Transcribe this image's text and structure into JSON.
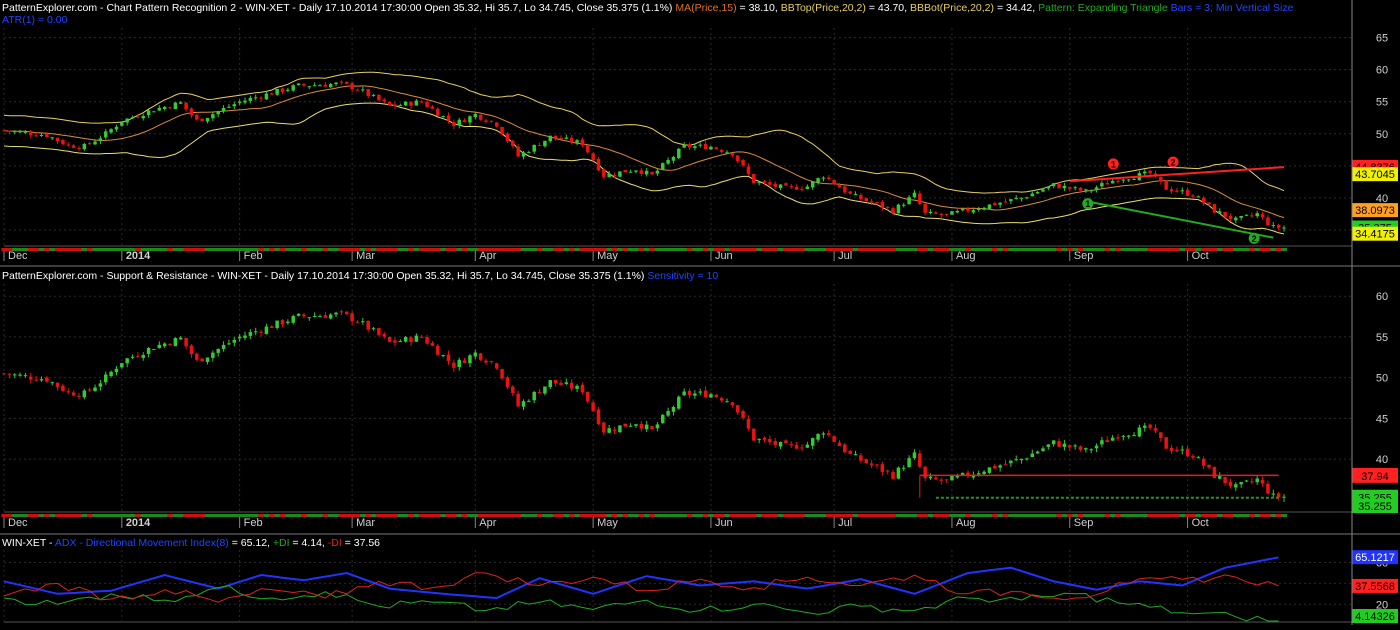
{
  "colors": {
    "bg": "#000000",
    "grid": "#2a2a2a",
    "axis_text": "#d0d0d0",
    "up": "#33cc33",
    "down": "#ee1111",
    "ma": "#d98c3a",
    "bbtop": "#e8d060",
    "bbbot": "#e8e070",
    "pattern_red": "#ff2020",
    "pattern_green": "#22aa22",
    "adx": "#2233ff",
    "plus_di": "#22aa22",
    "minus_di": "#dd2222",
    "support": "#2f8f2f",
    "resistance": "#e02020",
    "info_blue": "#2244ff"
  },
  "panel1": {
    "header": [
      {
        "text": "PatternExplorer.com - Chart Pattern Recognition 2 - WIN-XET - Daily 17.10.2014 17:30:00 Open 35.32, Hi 35.7, Lo 34.745, Close 35.375 (1.1%) ",
        "color": "#ffffff"
      },
      {
        "text": "MA(Price,15)",
        "color": "#e07020"
      },
      {
        "text": " = 38.10, ",
        "color": "#ffffff"
      },
      {
        "text": "BBTop(Price,20,2)",
        "color": "#e8d060"
      },
      {
        "text": " = 43.70, ",
        "color": "#ffffff"
      },
      {
        "text": "BBBot(Price,20,2)",
        "color": "#e8d060"
      },
      {
        "text": " = 34.42, ",
        "color": "#ffffff"
      },
      {
        "text": "Pattern: Expanding Triangle",
        "color": "#22aa22"
      },
      {
        "text": "  Bars = 3; Min Vertical Size",
        "color": "#2244ff"
      }
    ],
    "subheader": "ATR(1) = 0.00",
    "yticks": [
      "65",
      "60",
      "55",
      "50",
      "45",
      "40",
      "35"
    ],
    "ylim": [
      32.5,
      66.5
    ],
    "price_tags": [
      {
        "label": "44.8376",
        "value": 44.8376,
        "bg": "#ff2020",
        "fg": "#000000"
      },
      {
        "label": "43.7045",
        "value": 43.7045,
        "bg": "#f0f000",
        "fg": "#000000"
      },
      {
        "label": "38.0973",
        "value": 38.0973,
        "bg": "#ffa020",
        "fg": "#000000"
      },
      {
        "label": "35.3759",
        "value": 35.3759,
        "bg": "#22cc22",
        "fg": "#000000"
      },
      {
        "label": "35.375",
        "value": 35.375,
        "bg": "#22cc22",
        "fg": "#000000"
      },
      {
        "label": "34.4175",
        "value": 34.4175,
        "bg": "#f0f000",
        "fg": "#000000"
      }
    ],
    "pattern_markers": [
      {
        "label": "1",
        "day": 260,
        "value": 45.3,
        "color": "#ff2020"
      },
      {
        "label": "2",
        "day": 274,
        "value": 45.6,
        "color": "#ff2020"
      },
      {
        "label": "1",
        "day": 254,
        "value": 39.1,
        "color": "#22aa22"
      },
      {
        "label": "2",
        "day": 293,
        "value": 33.7,
        "color": "#22aa22"
      }
    ]
  },
  "panel2": {
    "header": [
      {
        "text": "PatternExplorer.com - Support & Resistance - WIN-XET - Daily 17.10.2014 17:30:00 Open 35.32, Hi 35.7, Lo 34.745, Close 35.375 (1.1%) ",
        "color": "#ffffff"
      },
      {
        "text": "Sensitivity = 10",
        "color": "#2244ff"
      }
    ],
    "yticks": [
      "60",
      "55",
      "50",
      "45",
      "40"
    ],
    "ylim": [
      33.5,
      61.5
    ],
    "price_tags": [
      {
        "label": "38.05",
        "value": 38.05,
        "bg": "#ff2020",
        "fg": "#000000"
      },
      {
        "label": "37.94",
        "value": 37.94,
        "bg": "#ff2020",
        "fg": "#000000"
      },
      {
        "label": "35.375",
        "value": 35.375,
        "bg": "#22cc22",
        "fg": "#000000"
      },
      {
        "label": "35.255",
        "value": 35.255,
        "bg": "#22cc22",
        "fg": "#000000"
      },
      {
        "label": "35.255",
        "value": 34.0,
        "bg": "#22cc22",
        "fg": "#000000"
      }
    ]
  },
  "panel3": {
    "header": [
      {
        "text": "WIN-XET - ",
        "color": "#ffffff"
      },
      {
        "text": "ADX - Directional Movement Index(8)",
        "color": "#2244ff"
      },
      {
        "text": " = 65.12, ",
        "color": "#ffffff"
      },
      {
        "text": "+DI",
        "color": "#22aa22"
      },
      {
        "text": " = 4.14, ",
        "color": "#ffffff"
      },
      {
        "text": "-DI",
        "color": "#dd2222"
      },
      {
        "text": " = 37.56",
        "color": "#ffffff"
      }
    ],
    "yticks": [
      "60",
      "40",
      "20"
    ],
    "ylim": [
      3,
      72
    ],
    "value_tags": [
      {
        "label": "65.1217",
        "value": 65.12,
        "bg": "#2233ff",
        "fg": "#ffffff"
      },
      {
        "label": "37.5568",
        "value": 37.56,
        "bg": "#ff2020",
        "fg": "#000000"
      },
      {
        "label": "4.14326",
        "value": 4.14,
        "bg": "#22cc22",
        "fg": "#000000"
      }
    ]
  },
  "months": [
    {
      "label": "Dec",
      "day": 0
    },
    {
      "label": "2014",
      "day": 22
    },
    {
      "label": "Feb",
      "day": 44
    },
    {
      "label": "Mar",
      "day": 65
    },
    {
      "label": "Apr",
      "day": 88
    },
    {
      "label": "May",
      "day": 110
    },
    {
      "label": "Jun",
      "day": 132
    },
    {
      "label": "Jul",
      "day": 155
    },
    {
      "label": "Aug",
      "day": 177
    },
    {
      "label": "Sep",
      "day": 199
    },
    {
      "label": "Oct",
      "day": 221
    }
  ],
  "chart_data": [
    {
      "type": "candlestick",
      "panel": "Chart Pattern Recognition 2",
      "symbol": "WIN-XET",
      "last_bar": {
        "date": "17.10.2014 17:30:00",
        "open": 35.32,
        "high": 35.7,
        "low": 34.745,
        "close": 35.375,
        "change_pct": 1.1
      },
      "ylim": [
        32.5,
        66.5
      ],
      "anchors": [
        {
          "day": 0,
          "value": 50.5
        },
        {
          "day": 8,
          "value": 49.8
        },
        {
          "day": 12,
          "value": 48.2
        },
        {
          "day": 15,
          "value": 48.0
        },
        {
          "day": 19,
          "value": 50.0
        },
        {
          "day": 22,
          "value": 52.0
        },
        {
          "day": 28,
          "value": 53.8
        },
        {
          "day": 33,
          "value": 54.8
        },
        {
          "day": 36,
          "value": 52.0
        },
        {
          "day": 40,
          "value": 53.5
        },
        {
          "day": 44,
          "value": 55.0
        },
        {
          "day": 55,
          "value": 57.5
        },
        {
          "day": 63,
          "value": 57.8
        },
        {
          "day": 66,
          "value": 57.0
        },
        {
          "day": 72,
          "value": 54.3
        },
        {
          "day": 78,
          "value": 55.0
        },
        {
          "day": 84,
          "value": 51.5
        },
        {
          "day": 88,
          "value": 53.0
        },
        {
          "day": 92,
          "value": 51.5
        },
        {
          "day": 96,
          "value": 46.5
        },
        {
          "day": 102,
          "value": 49.5
        },
        {
          "day": 108,
          "value": 48.5
        },
        {
          "day": 112,
          "value": 43.5
        },
        {
          "day": 118,
          "value": 44.5
        },
        {
          "day": 121,
          "value": 43.5
        },
        {
          "day": 127,
          "value": 48.0
        },
        {
          "day": 132,
          "value": 48.0
        },
        {
          "day": 136,
          "value": 47.0
        },
        {
          "day": 140,
          "value": 42.5
        },
        {
          "day": 146,
          "value": 41.5
        },
        {
          "day": 150,
          "value": 41.8
        },
        {
          "day": 153,
          "value": 43.5
        },
        {
          "day": 158,
          "value": 40.5
        },
        {
          "day": 166,
          "value": 38.0
        },
        {
          "day": 170,
          "value": 40.5
        },
        {
          "day": 172,
          "value": 37.5
        },
        {
          "day": 176,
          "value": 37.3
        },
        {
          "day": 182,
          "value": 38.5
        },
        {
          "day": 190,
          "value": 40.0
        },
        {
          "day": 196,
          "value": 42.0
        },
        {
          "day": 202,
          "value": 41.0
        },
        {
          "day": 208,
          "value": 43.0
        },
        {
          "day": 214,
          "value": 43.8
        },
        {
          "day": 217,
          "value": 41.5
        },
        {
          "day": 222,
          "value": 40.5
        },
        {
          "day": 226,
          "value": 38.0
        },
        {
          "day": 230,
          "value": 36.5
        },
        {
          "day": 234,
          "value": 37.5
        },
        {
          "day": 237,
          "value": 35.4
        }
      ],
      "indicators": {
        "MA(Price,15)": 38.1,
        "BBTop(Price,20,2)": 43.7,
        "BBBot(Price,20,2)": 34.42,
        "ATR(1)": 0.0
      },
      "pattern": "Expanding Triangle"
    },
    {
      "type": "candlestick",
      "panel": "Support & Resistance",
      "symbol": "WIN-XET",
      "sensitivity": 10,
      "resistance": {
        "value": 38.0,
        "from_day": 171,
        "to_day": 238
      },
      "support": {
        "value": 35.255,
        "from_day": 174,
        "to_day": 238
      }
    },
    {
      "type": "line",
      "panel": "ADX - Directional Movement Index(8)",
      "ylim": [
        3,
        72
      ],
      "series": [
        {
          "name": "ADX",
          "last": 65.12,
          "points": [
            {
              "day": 0,
              "value": 42
            },
            {
              "day": 10,
              "value": 30
            },
            {
              "day": 20,
              "value": 33
            },
            {
              "day": 30,
              "value": 48
            },
            {
              "day": 40,
              "value": 35
            },
            {
              "day": 48,
              "value": 48
            },
            {
              "day": 56,
              "value": 43
            },
            {
              "day": 64,
              "value": 50
            },
            {
              "day": 72,
              "value": 35
            },
            {
              "day": 82,
              "value": 30
            },
            {
              "day": 92,
              "value": 26
            },
            {
              "day": 100,
              "value": 45
            },
            {
              "day": 110,
              "value": 30
            },
            {
              "day": 120,
              "value": 47
            },
            {
              "day": 130,
              "value": 38
            },
            {
              "day": 140,
              "value": 42
            },
            {
              "day": 150,
              "value": 35
            },
            {
              "day": 160,
              "value": 44
            },
            {
              "day": 170,
              "value": 30
            },
            {
              "day": 180,
              "value": 50
            },
            {
              "day": 188,
              "value": 55
            },
            {
              "day": 196,
              "value": 42
            },
            {
              "day": 204,
              "value": 34
            },
            {
              "day": 212,
              "value": 42
            },
            {
              "day": 220,
              "value": 38
            },
            {
              "day": 228,
              "value": 55
            },
            {
              "day": 238,
              "value": 65
            }
          ]
        },
        {
          "name": "+DI",
          "last": 4.14,
          "points": [
            {
              "day": 0,
              "value": 26
            },
            {
              "day": 10,
              "value": 20
            },
            {
              "day": 20,
              "value": 30
            },
            {
              "day": 30,
              "value": 24
            },
            {
              "day": 40,
              "value": 36
            },
            {
              "day": 50,
              "value": 26
            },
            {
              "day": 60,
              "value": 32
            },
            {
              "day": 70,
              "value": 18
            },
            {
              "day": 80,
              "value": 22
            },
            {
              "day": 90,
              "value": 14
            },
            {
              "day": 100,
              "value": 22
            },
            {
              "day": 110,
              "value": 15
            },
            {
              "day": 120,
              "value": 24
            },
            {
              "day": 130,
              "value": 14
            },
            {
              "day": 140,
              "value": 20
            },
            {
              "day": 150,
              "value": 12
            },
            {
              "day": 160,
              "value": 18
            },
            {
              "day": 170,
              "value": 14
            },
            {
              "day": 180,
              "value": 26
            },
            {
              "day": 190,
              "value": 24
            },
            {
              "day": 200,
              "value": 30
            },
            {
              "day": 210,
              "value": 20
            },
            {
              "day": 220,
              "value": 12
            },
            {
              "day": 230,
              "value": 8
            },
            {
              "day": 238,
              "value": 4
            }
          ]
        },
        {
          "name": "-DI",
          "last": 37.56,
          "points": [
            {
              "day": 0,
              "value": 28
            },
            {
              "day": 10,
              "value": 40
            },
            {
              "day": 20,
              "value": 25
            },
            {
              "day": 30,
              "value": 34
            },
            {
              "day": 40,
              "value": 22
            },
            {
              "day": 50,
              "value": 34
            },
            {
              "day": 60,
              "value": 26
            },
            {
              "day": 70,
              "value": 42
            },
            {
              "day": 80,
              "value": 36
            },
            {
              "day": 90,
              "value": 50
            },
            {
              "day": 100,
              "value": 38
            },
            {
              "day": 110,
              "value": 46
            },
            {
              "day": 120,
              "value": 33
            },
            {
              "day": 130,
              "value": 44
            },
            {
              "day": 140,
              "value": 36
            },
            {
              "day": 150,
              "value": 46
            },
            {
              "day": 160,
              "value": 38
            },
            {
              "day": 170,
              "value": 48
            },
            {
              "day": 180,
              "value": 30
            },
            {
              "day": 190,
              "value": 32
            },
            {
              "day": 200,
              "value": 26
            },
            {
              "day": 210,
              "value": 40
            },
            {
              "day": 220,
              "value": 44
            },
            {
              "day": 230,
              "value": 46
            },
            {
              "day": 238,
              "value": 37.56
            }
          ]
        }
      ]
    }
  ]
}
